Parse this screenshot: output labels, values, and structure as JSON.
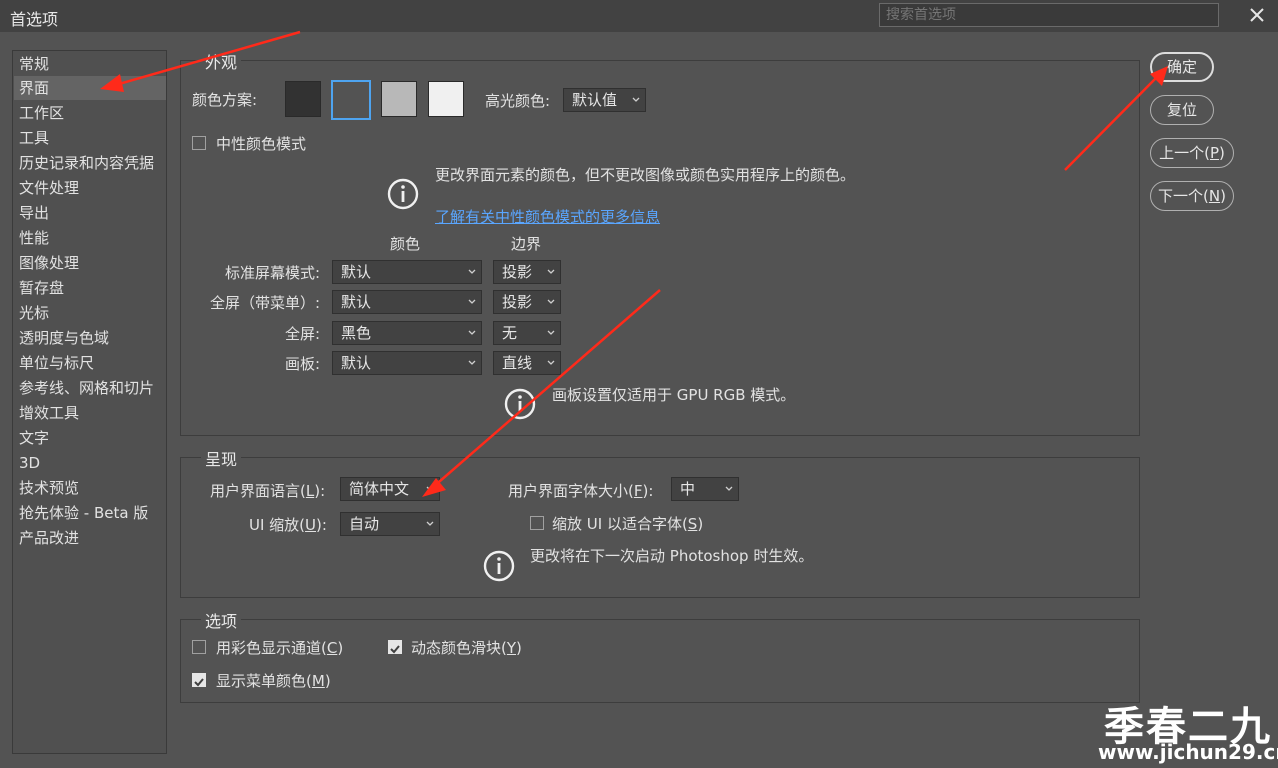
{
  "window": {
    "title": "首选项",
    "search_placeholder": "搜索首选项"
  },
  "sidebar": {
    "items": [
      {
        "label": "常规"
      },
      {
        "label": "界面",
        "selected": true
      },
      {
        "label": "工作区"
      },
      {
        "label": "工具"
      },
      {
        "label": "历史记录和内容凭据"
      },
      {
        "label": "文件处理"
      },
      {
        "label": "导出"
      },
      {
        "label": "性能"
      },
      {
        "label": "图像处理"
      },
      {
        "label": "暂存盘"
      },
      {
        "label": "光标"
      },
      {
        "label": "透明度与色域"
      },
      {
        "label": "单位与标尺"
      },
      {
        "label": "参考线、网格和切片"
      },
      {
        "label": "增效工具"
      },
      {
        "label": "文字"
      },
      {
        "label": "3D"
      },
      {
        "label": "技术预览"
      },
      {
        "label": "抢先体验 - Beta 版"
      },
      {
        "label": "产品改进"
      }
    ]
  },
  "appearance": {
    "legend": "外观",
    "color_scheme_label": "颜色方案:",
    "swatch_colors": [
      "#323232",
      "#535353",
      "#b8b8b8",
      "#f0f0f0"
    ],
    "selected_swatch": 2,
    "highlight_label": "高光颜色:",
    "highlight_value": "默认值",
    "neutral_mode_label": "中性颜色模式",
    "neutral_mode_checked": false,
    "info_text": "更改界面元素的颜色，但不更改图像或颜色实用程序上的颜色。",
    "info_link": "了解有关中性颜色模式的更多信息",
    "col_color": "颜色",
    "col_border": "边界",
    "rows": [
      {
        "label": "标准屏幕模式:",
        "color": "默认",
        "border": "投影"
      },
      {
        "label": "全屏（带菜单）:",
        "color": "默认",
        "border": "投影"
      },
      {
        "label": "全屏:",
        "color": "黑色",
        "border": "无"
      },
      {
        "label": "画板:",
        "color": "默认",
        "border": "直线"
      }
    ],
    "artboard_note": "画板设置仅适用于 GPU RGB 模式。"
  },
  "presentation": {
    "legend": "呈现",
    "ui_language_label": "用户界面语言(",
    "ui_language_key": "L",
    "ui_language_value": "简体中文",
    "font_size_label": "用户界面字体大小(",
    "font_size_key": "F",
    "font_size_value": "中",
    "ui_scale_label": "UI 缩放(",
    "ui_scale_key": "U",
    "ui_scale_value": "自动",
    "scale_fit_label": "缩放 UI 以适合字体(",
    "scale_fit_key": "S",
    "scale_fit_checked": false,
    "restart_note": "更改将在下一次启动 Photoshop 时生效。"
  },
  "options": {
    "legend": "选项",
    "show_channels_label": "用彩色显示通道(",
    "show_channels_key": "C",
    "show_channels_checked": false,
    "dynamic_sliders_label": "动态颜色滑块(",
    "dynamic_sliders_key": "Y",
    "dynamic_sliders_checked": true,
    "menu_colors_label": "显示菜单颜色(",
    "menu_colors_key": "M",
    "menu_colors_checked": true
  },
  "buttons": {
    "ok": "确定",
    "reset": "复位",
    "prev": "上一个(",
    "prev_key": "P",
    "next": "下一个(",
    "next_key": "N",
    "close_paren": ")"
  },
  "watermark": {
    "name": "季春二九",
    "url": "www.jichun29.cn"
  },
  "colors": {
    "annotation_arrow": "#ff2a1a",
    "link": "#5aa6ff",
    "dialog_bg": "#535353"
  },
  "icons": [
    "close-icon",
    "info-icon",
    "chevron-down-icon",
    "checkmark-icon",
    "annotation-arrow"
  ]
}
